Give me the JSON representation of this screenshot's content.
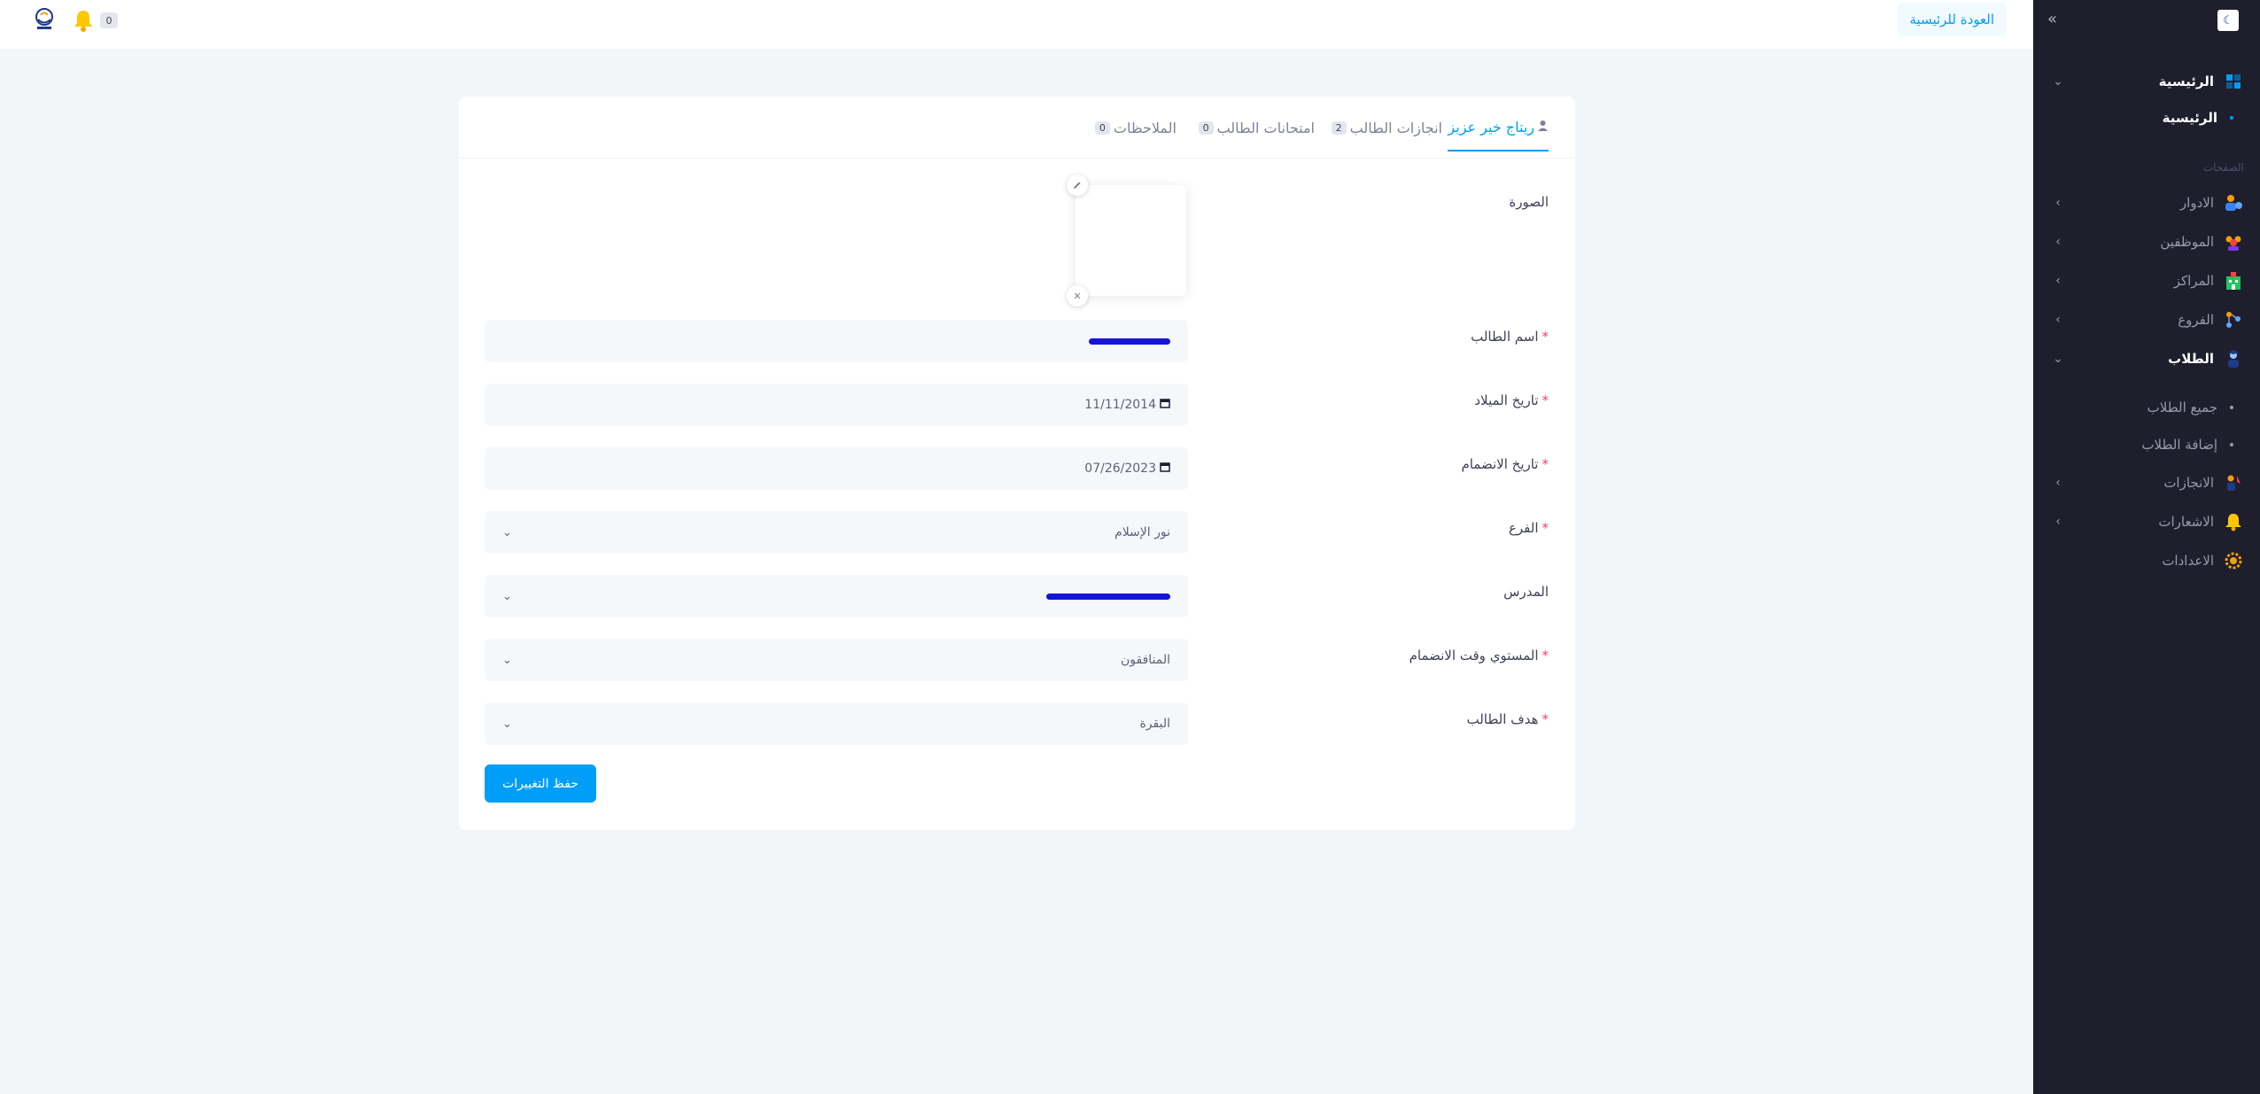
{
  "topbar": {
    "back_label": "العودة للرئيسية",
    "notif_count": "0"
  },
  "sidebar": {
    "section_label": "الصفحات",
    "home": {
      "label": "الرئيسية",
      "sub": "الرئيسية"
    },
    "items": [
      {
        "label": "الادوار",
        "icon": "roles-icon"
      },
      {
        "label": "الموظفين",
        "icon": "employees-icon"
      },
      {
        "label": "المراكز",
        "icon": "centers-icon"
      },
      {
        "label": "الفروع",
        "icon": "branches-icon"
      }
    ],
    "students": {
      "label": "الطلاب",
      "subs": [
        "جميع الطلاب",
        "إضافة الطلاب"
      ]
    },
    "bottom_items": [
      {
        "label": "الانجازات"
      },
      {
        "label": "الاشعارات"
      },
      {
        "label": "الاعدادات"
      }
    ]
  },
  "tabs": [
    {
      "label": "ريتاج خير عزيز",
      "active": true
    },
    {
      "label": "انجازات الطالب",
      "count": "2"
    },
    {
      "label": "امتحانات الطالب",
      "count": "0"
    },
    {
      "label": "الملاحظات",
      "count": "0"
    }
  ],
  "form": {
    "image_label": "الصورة",
    "name_label": "اسم الطالب",
    "birth_label": "تاريخ الميلاد",
    "birth_value": "11/11/2014",
    "join_label": "تاريخ الانضمام",
    "join_value": "07/26/2023",
    "branch_label": "الفرع",
    "branch_value": "نور الإسلام",
    "teacher_label": "المدرس",
    "level_label": "المستوي وقت الانضمام",
    "level_value": "المنافقون",
    "goal_label": "هدف الطالب",
    "goal_value": "البقرة",
    "required_mark": "*",
    "save_label": "حفظ التغييرات"
  },
  "colors": {
    "primary": "#009ef7",
    "sidebar_bg": "#1e1e2d",
    "page_bg": "#f3f6f9",
    "required": "#f1416c",
    "redaction": "#1515d8"
  }
}
